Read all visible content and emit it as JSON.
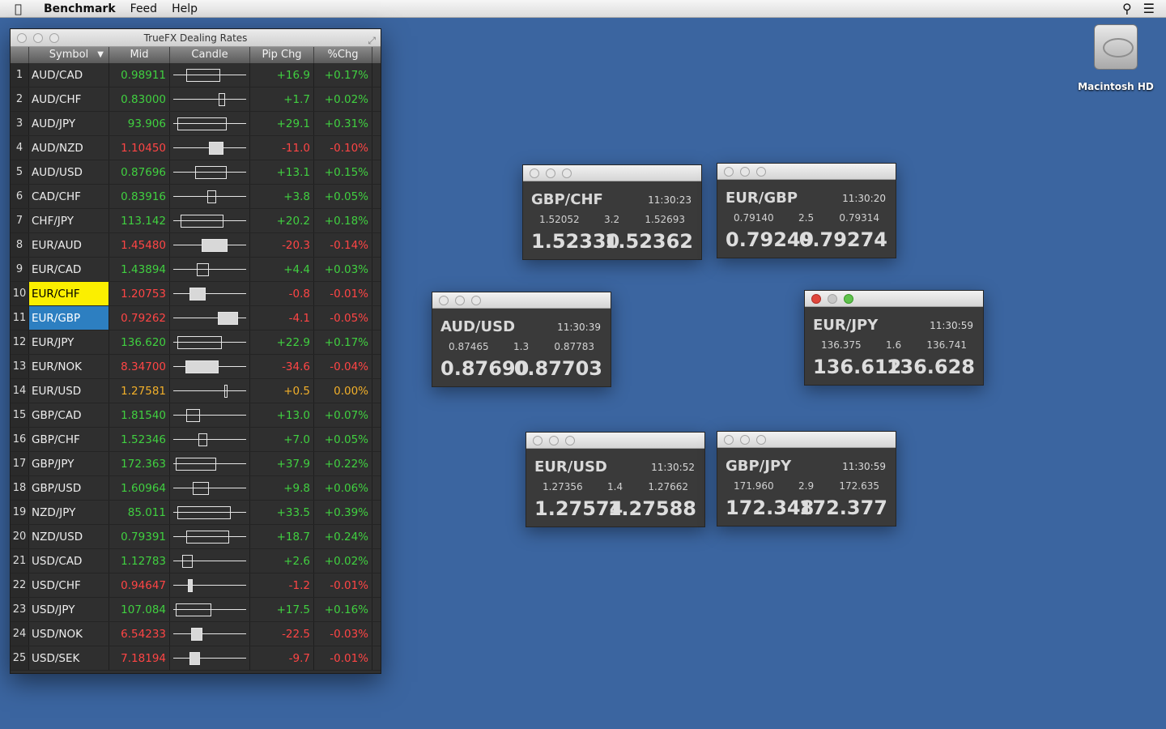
{
  "menubar": {
    "app": "Benchmark",
    "items": [
      "Feed",
      "Help"
    ]
  },
  "desktop": {
    "hd_label": "Macintosh HD"
  },
  "main_window": {
    "title": "TrueFX Dealing Rates",
    "columns": {
      "symbol": "Symbol",
      "mid": "Mid",
      "candle": "Candle",
      "pip": "Pip Chg",
      "pct": "%Chg"
    },
    "rows": [
      {
        "n": "1",
        "sym": "AUD/CAD",
        "mid": "0.98911",
        "pip": "+16.9",
        "pct": "+0.17%",
        "dir": "pos",
        "body": [
          18,
          64
        ],
        "filled": false
      },
      {
        "n": "2",
        "sym": "AUD/CHF",
        "mid": "0.83000",
        "pip": "+1.7",
        "pct": "+0.02%",
        "dir": "pos",
        "body": [
          62,
          70
        ],
        "filled": false
      },
      {
        "n": "3",
        "sym": "AUD/JPY",
        "mid": "93.906",
        "pip": "+29.1",
        "pct": "+0.31%",
        "dir": "pos",
        "body": [
          5,
          72
        ],
        "filled": false
      },
      {
        "n": "4",
        "sym": "AUD/NZD",
        "mid": "1.10450",
        "pip": "-11.0",
        "pct": "-0.10%",
        "dir": "neg",
        "body": [
          48,
          68
        ],
        "filled": true
      },
      {
        "n": "5",
        "sym": "AUD/USD",
        "mid": "0.87696",
        "pip": "+13.1",
        "pct": "+0.15%",
        "dir": "pos",
        "body": [
          30,
          72
        ],
        "filled": false
      },
      {
        "n": "6",
        "sym": "CAD/CHF",
        "mid": "0.83916",
        "pip": "+3.8",
        "pct": "+0.05%",
        "dir": "pos",
        "body": [
          46,
          58
        ],
        "filled": false
      },
      {
        "n": "7",
        "sym": "CHF/JPY",
        "mid": "113.142",
        "pip": "+20.2",
        "pct": "+0.18%",
        "dir": "pos",
        "body": [
          10,
          68
        ],
        "filled": false
      },
      {
        "n": "8",
        "sym": "EUR/AUD",
        "mid": "1.45480",
        "pip": "-20.3",
        "pct": "-0.14%",
        "dir": "neg",
        "body": [
          38,
          74
        ],
        "filled": true
      },
      {
        "n": "9",
        "sym": "EUR/CAD",
        "mid": "1.43894",
        "pip": "+4.4",
        "pct": "+0.03%",
        "dir": "pos",
        "body": [
          32,
          48
        ],
        "filled": false
      },
      {
        "n": "10",
        "sym": "EUR/CHF",
        "mid": "1.20753",
        "pip": "-0.8",
        "pct": "-0.01%",
        "dir": "neg",
        "body": [
          22,
          44
        ],
        "filled": true,
        "sel": "yellow"
      },
      {
        "n": "11",
        "sym": "EUR/GBP",
        "mid": "0.79262",
        "pip": "-4.1",
        "pct": "-0.05%",
        "dir": "neg",
        "body": [
          60,
          88
        ],
        "filled": true,
        "sel": "blue"
      },
      {
        "n": "12",
        "sym": "EUR/JPY",
        "mid": "136.620",
        "pip": "+22.9",
        "pct": "+0.17%",
        "dir": "pos",
        "body": [
          5,
          66
        ],
        "filled": false
      },
      {
        "n": "13",
        "sym": "EUR/NOK",
        "mid": "8.34700",
        "pip": "-34.6",
        "pct": "-0.04%",
        "dir": "neg",
        "body": [
          16,
          62
        ],
        "filled": true
      },
      {
        "n": "14",
        "sym": "EUR/USD",
        "mid": "1.27581",
        "pip": "+0.5",
        "pct": "0.00%",
        "dir": "zero",
        "body": [
          69,
          73
        ],
        "filled": false
      },
      {
        "n": "15",
        "sym": "GBP/CAD",
        "mid": "1.81540",
        "pip": "+13.0",
        "pct": "+0.07%",
        "dir": "pos",
        "body": [
          18,
          36
        ],
        "filled": false
      },
      {
        "n": "16",
        "sym": "GBP/CHF",
        "mid": "1.52346",
        "pip": "+7.0",
        "pct": "+0.05%",
        "dir": "pos",
        "body": [
          34,
          46
        ],
        "filled": false
      },
      {
        "n": "17",
        "sym": "GBP/JPY",
        "mid": "172.363",
        "pip": "+37.9",
        "pct": "+0.22%",
        "dir": "pos",
        "body": [
          3,
          58
        ],
        "filled": false
      },
      {
        "n": "18",
        "sym": "GBP/USD",
        "mid": "1.60964",
        "pip": "+9.8",
        "pct": "+0.06%",
        "dir": "pos",
        "body": [
          26,
          48
        ],
        "filled": false
      },
      {
        "n": "19",
        "sym": "NZD/JPY",
        "mid": "85.011",
        "pip": "+33.5",
        "pct": "+0.39%",
        "dir": "pos",
        "body": [
          5,
          78
        ],
        "filled": false
      },
      {
        "n": "20",
        "sym": "NZD/USD",
        "mid": "0.79391",
        "pip": "+18.7",
        "pct": "+0.24%",
        "dir": "pos",
        "body": [
          18,
          76
        ],
        "filled": false
      },
      {
        "n": "21",
        "sym": "USD/CAD",
        "mid": "1.12783",
        "pip": "+2.6",
        "pct": "+0.02%",
        "dir": "pos",
        "body": [
          12,
          26
        ],
        "filled": false
      },
      {
        "n": "22",
        "sym": "USD/CHF",
        "mid": "0.94647",
        "pip": "-1.2",
        "pct": "-0.01%",
        "dir": "neg",
        "body": [
          20,
          26
        ],
        "filled": true
      },
      {
        "n": "23",
        "sym": "USD/JPY",
        "mid": "107.084",
        "pip": "+17.5",
        "pct": "+0.16%",
        "dir": "pos",
        "body": [
          3,
          52
        ],
        "filled": false
      },
      {
        "n": "24",
        "sym": "USD/NOK",
        "mid": "6.54233",
        "pip": "-22.5",
        "pct": "-0.03%",
        "dir": "neg",
        "body": [
          24,
          40
        ],
        "filled": true
      },
      {
        "n": "25",
        "sym": "USD/SEK",
        "mid": "7.18194",
        "pip": "-9.7",
        "pct": "-0.01%",
        "dir": "neg",
        "body": [
          22,
          36
        ],
        "filled": true
      }
    ]
  },
  "quotes": [
    {
      "sym": "GBP/CHF",
      "time": "11:30:23",
      "lo": "1.52052",
      "spread": "3.2",
      "hi": "1.52693",
      "bid": "1.52330",
      "ask": "1.52362",
      "active": false
    },
    {
      "sym": "EUR/GBP",
      "time": "11:30:20",
      "lo": "0.79140",
      "spread": "2.5",
      "hi": "0.79314",
      "bid": "0.79249",
      "ask": "0.79274",
      "active": false
    },
    {
      "sym": "AUD/USD",
      "time": "11:30:39",
      "lo": "0.87465",
      "spread": "1.3",
      "hi": "0.87783",
      "bid": "0.87690",
      "ask": "0.87703",
      "active": false
    },
    {
      "sym": "EUR/JPY",
      "time": "11:30:59",
      "lo": "136.375",
      "spread": "1.6",
      "hi": "136.741",
      "bid": "136.612",
      "ask": "136.628",
      "active": true
    },
    {
      "sym": "EUR/USD",
      "time": "11:30:52",
      "lo": "1.27356",
      "spread": "1.4",
      "hi": "1.27662",
      "bid": "1.27574",
      "ask": "1.27588",
      "active": false
    },
    {
      "sym": "GBP/JPY",
      "time": "11:30:59",
      "lo": "171.960",
      "spread": "2.9",
      "hi": "172.635",
      "bid": "172.348",
      "ask": "172.377",
      "active": false
    }
  ]
}
